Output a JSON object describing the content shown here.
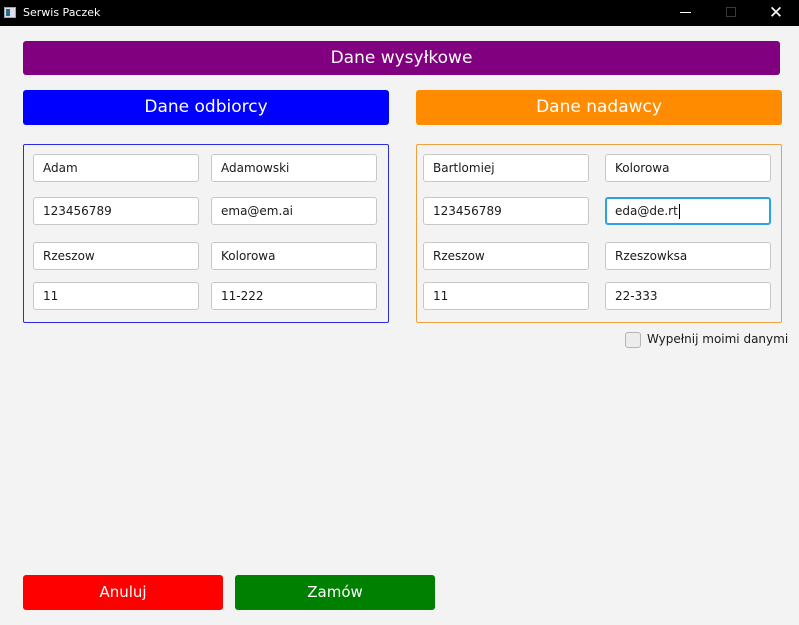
{
  "window": {
    "title": "Serwis Paczek"
  },
  "header": {
    "title": "Dane wysyłkowe"
  },
  "recipient": {
    "title": "Dane odbiorcy",
    "first_name": "Adam",
    "last_name": "Adamowski",
    "phone": "123456789",
    "email": "ema@em.ai",
    "city": "Rzeszow",
    "street": "Kolorowa",
    "house_number": "11",
    "postal_code": "11-222"
  },
  "sender": {
    "title": "Dane nadawcy",
    "first_name": "Bartlomiej",
    "last_name": "Kolorowa",
    "phone": "123456789",
    "email": "eda@de.rt",
    "city": "Rzeszow",
    "street": "Rzeszowksa",
    "house_number": "11",
    "postal_code": "22-333"
  },
  "fill_with_my_data": {
    "label": "Wypełnij moimi danymi",
    "checked": false
  },
  "actions": {
    "cancel_label": "Anuluj",
    "order_label": "Zamów"
  },
  "colors": {
    "header": "#800080",
    "recipient": "#0000ff",
    "sender": "#ff8c00",
    "cancel": "#ff0000",
    "order": "#008000",
    "focus": "#2aa3e0"
  },
  "icons": {
    "app": "app-icon",
    "minimize": "minimize-icon",
    "maximize": "maximize-icon",
    "close": "close-icon"
  }
}
